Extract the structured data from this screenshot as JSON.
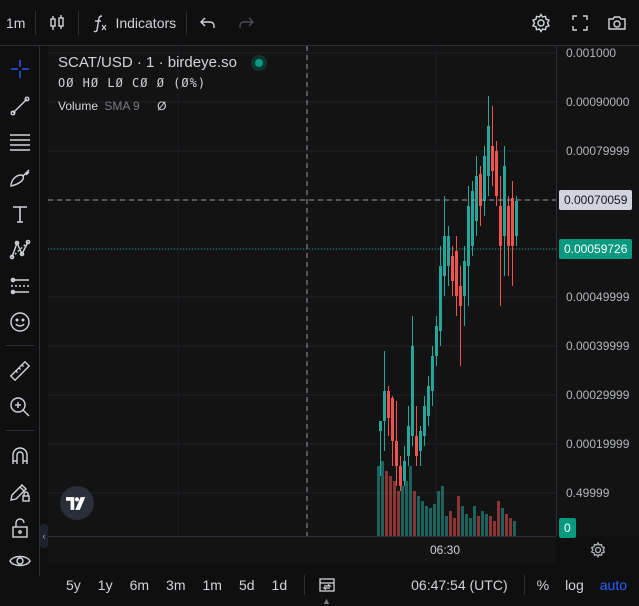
{
  "toolbar": {
    "interval": "1m",
    "indicators_label": "Indicators"
  },
  "legend": {
    "title": "SCAT/USD · 1 · birdeye.so",
    "ohlc": "OØ HØ LØ CØ Ø (Ø%)",
    "volume_label": "Volume",
    "volume_sma": "SMA 9",
    "volume_value": "Ø"
  },
  "price_axis": {
    "labels": [
      "0.001000",
      "0.00090000",
      "0.00079999",
      "0.00049999",
      "0.00039999",
      "0.00029999",
      "0.00019999",
      "0.49999"
    ],
    "crosshair_value": "0.00070059",
    "last_price": "0.00059726",
    "volume_tag": "0"
  },
  "time_axis": {
    "label": "06:30"
  },
  "bottom": {
    "ranges": [
      "5y",
      "1y",
      "6m",
      "3m",
      "1m",
      "5d",
      "1d"
    ],
    "clock": "06:47:54 (UTC)",
    "percent_label": "%",
    "log_label": "log",
    "auto_label": "auto"
  },
  "colors": {
    "up": "#26a69a",
    "down": "#ef5350",
    "accent": "#2962ff",
    "last_price_tag": "#089981"
  },
  "icons": [
    "candles-icon",
    "undo-icon",
    "redo-icon",
    "settings-icon",
    "fullscreen-icon",
    "camera-icon",
    "crosshair-icon",
    "trendline-icon",
    "fib-icon",
    "brush-icon",
    "text-icon",
    "pattern-icon",
    "forecast-icon",
    "emoji-icon",
    "ruler-icon",
    "zoom-in-icon",
    "magnet-icon",
    "lock-drawing-icon",
    "lock-icon",
    "eye-icon",
    "compare-icon"
  ]
}
